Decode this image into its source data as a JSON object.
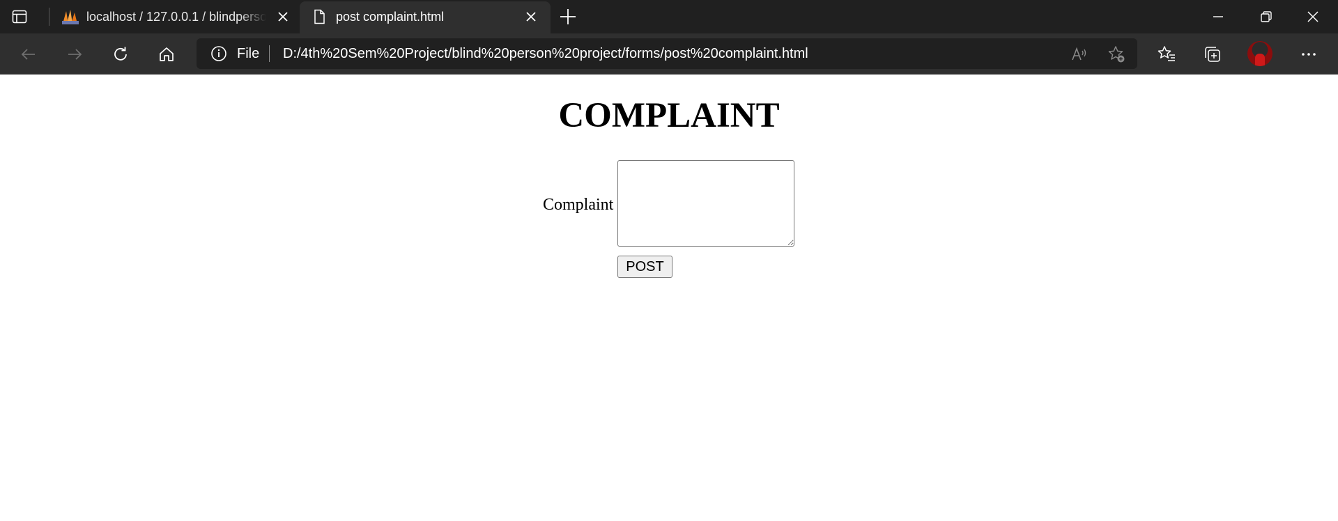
{
  "browser": {
    "tabs": [
      {
        "title": "localhost / 127.0.0.1 / blindperso",
        "favicon": "phpmyadmin-icon",
        "active": false
      },
      {
        "title": "post complaint.html",
        "favicon": "document-icon",
        "active": true
      }
    ],
    "address_bar": {
      "scheme_label": "File",
      "url": "D:/4th%20Sem%20Project/blind%20person%20project/forms/post%20complaint.html"
    },
    "colors": {
      "tabstrip": "#202020",
      "toolbar": "#2f2f2f",
      "active_tab": "#2f2f2f",
      "text": "#ffffff"
    }
  },
  "page": {
    "title": "COMPLAINT",
    "form": {
      "complaint_label": "Complaint",
      "complaint_value": "",
      "submit_label": "POST"
    }
  }
}
